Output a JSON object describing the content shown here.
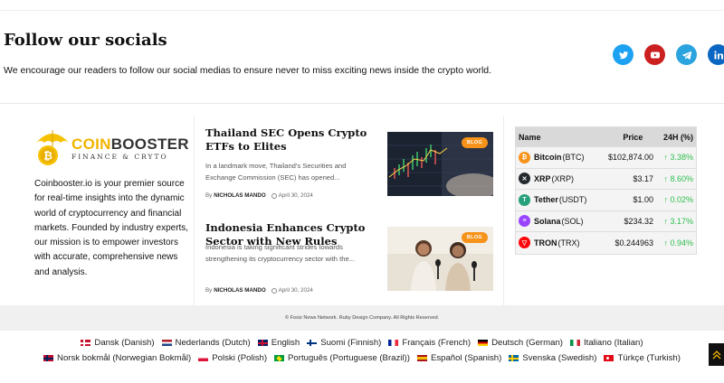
{
  "socials": {
    "title": "Follow our socials",
    "description": "We encourage our readers to follow our social medias to ensure never to miss exciting news inside the crypto world.",
    "icons": [
      {
        "icon": "twitter-icon",
        "color": "#1da1f2"
      },
      {
        "icon": "youtube-icon",
        "color": "#cc1f1f"
      },
      {
        "icon": "telegram-icon",
        "color": "#2aa3df"
      },
      {
        "icon": "linkedin-icon",
        "color": "#0a66c2"
      }
    ]
  },
  "brand": {
    "name_accent": "COIN",
    "name_rest": "BOOSTER",
    "tagline": "FINANCE & CRYTO",
    "description": "Coinbooster.io is your premier source for real-time insights into the dynamic world of cryptocurrency and financial markets. Founded by industry experts, our mission is to empower investors with accurate, comprehensive news and analysis."
  },
  "articles": [
    {
      "title": "Thailand SEC Opens Crypto ETFs to Elites",
      "excerpt": "In a landmark move, Thailand's Securities and Exchange Commission (SEC) has opened...",
      "by": "By",
      "author": "NICHOLAS MANDO",
      "date": "April 30, 2024",
      "badge": "BLOG"
    },
    {
      "title": "Indonesia Enhances Crypto Sector with New Rules",
      "excerpt": "Indonesia is taking significant strides towards strengthening its cryptocurrency sector with the...",
      "by": "By",
      "author": "NICHOLAS MANDO",
      "date": "April 30, 2024",
      "badge": "BLOG"
    }
  ],
  "prices": {
    "headers": {
      "name": "Name",
      "price": "Price",
      "change": "24H (%)"
    },
    "rows": [
      {
        "name": "Bitcoin",
        "symbol": "(BTC)",
        "price": "$102,874.00",
        "change": "↑ 3.38%",
        "icon_color": "#f7931a",
        "icon": "bitcoin-icon",
        "glyph": "₿"
      },
      {
        "name": "XRP",
        "symbol": "(XRP)",
        "price": "$3.17",
        "change": "↑ 8.60%",
        "icon_color": "#23292f",
        "icon": "xrp-icon",
        "glyph": "✕"
      },
      {
        "name": "Tether",
        "symbol": "(USDT)",
        "price": "$1.00",
        "change": "↑ 0.02%",
        "icon_color": "#26a17b",
        "icon": "tether-icon",
        "glyph": "T"
      },
      {
        "name": "Solana",
        "symbol": "(SOL)",
        "price": "$234.32",
        "change": "↑ 3.17%",
        "icon_color": "#9945ff",
        "icon": "solana-icon",
        "glyph": "≡"
      },
      {
        "name": "TRON",
        "symbol": "(TRX)",
        "price": "$0.244963",
        "change": "↑ 0.94%",
        "icon_color": "#ff060a",
        "icon": "tron-icon",
        "glyph": "▽"
      }
    ]
  },
  "footer": {
    "copyright": "© Foxiz News Network. Ruby Design Company. All Rights Reserved.",
    "languages_row1": [
      {
        "label": "Dansk (Danish)",
        "flag": "dk"
      },
      {
        "label": "Nederlands (Dutch)",
        "flag": "nl"
      },
      {
        "label": "English",
        "flag": "gb"
      },
      {
        "label": "Suomi (Finnish)",
        "flag": "fi"
      },
      {
        "label": "Français (French)",
        "flag": "fr"
      },
      {
        "label": "Deutsch (German)",
        "flag": "de"
      },
      {
        "label": "Italiano (Italian)",
        "flag": "it"
      }
    ],
    "languages_row2": [
      {
        "label": "Norsk bokmål (Norwegian Bokmål)",
        "flag": "no"
      },
      {
        "label": "Polski (Polish)",
        "flag": "pl"
      },
      {
        "label": "Português (Portuguese (Brazil))",
        "flag": "br"
      },
      {
        "label": "Español (Spanish)",
        "flag": "es"
      },
      {
        "label": "Svenska (Swedish)",
        "flag": "se"
      },
      {
        "label": "Türkçe (Turkish)",
        "flag": "tr"
      }
    ]
  }
}
